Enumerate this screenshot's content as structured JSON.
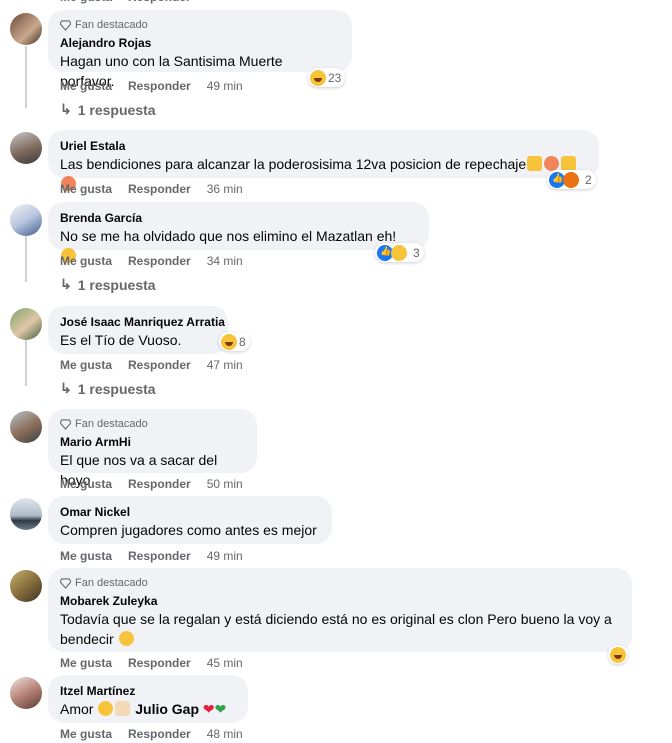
{
  "labels": {
    "fan": "Fan destacado",
    "like": "Me gusta",
    "reply": "Responder"
  },
  "comments": [
    {
      "name": "Alejandro Rojas",
      "fan": true,
      "text": "Hagan uno con la Santisima Muerte porfavor.",
      "reactions": "23",
      "time": "49 min",
      "replies": "1 respuesta"
    },
    {
      "name": "Uriel Estala",
      "fan": false,
      "text": "Las bendiciones para alcanzar la poderosisima 12va posicion de repechaje",
      "reactions": "2",
      "time": "36 min"
    },
    {
      "name": "Brenda García",
      "fan": false,
      "text": "No se me ha olvidado que nos elimino el Mazatlan eh!",
      "reactions": "3",
      "time": "34 min",
      "replies": "1 respuesta"
    },
    {
      "name": "José Isaac Manriquez Arratia",
      "fan": false,
      "text": "Es el Tío de Vuoso.",
      "reactions": "8",
      "time": "47 min",
      "replies": "1 respuesta"
    },
    {
      "name": "Mario ArmHi",
      "fan": true,
      "text": "El que nos va a sacar del hoyo",
      "time": "50 min"
    },
    {
      "name": "Omar Nickel",
      "fan": false,
      "text": "Compren jugadores como antes es mejor .",
      "time": "49 min"
    },
    {
      "name": "Mobarek Zuleyka",
      "fan": true,
      "text_line1": "Todavía que se la regalan y está diciendo está no es original es clon Pero bueno la voy a",
      "text_line2": "bendecir",
      "time": "45 min"
    },
    {
      "name": "Itzel Martínez",
      "fan": false,
      "text_prefix": "Amor",
      "mention": "Julio Gap",
      "time": "48 min"
    }
  ],
  "colors": {
    "bubble": "#f0f2f5",
    "muted": "#65676b",
    "like": "#1877f2",
    "haha": "#f7c33b"
  }
}
